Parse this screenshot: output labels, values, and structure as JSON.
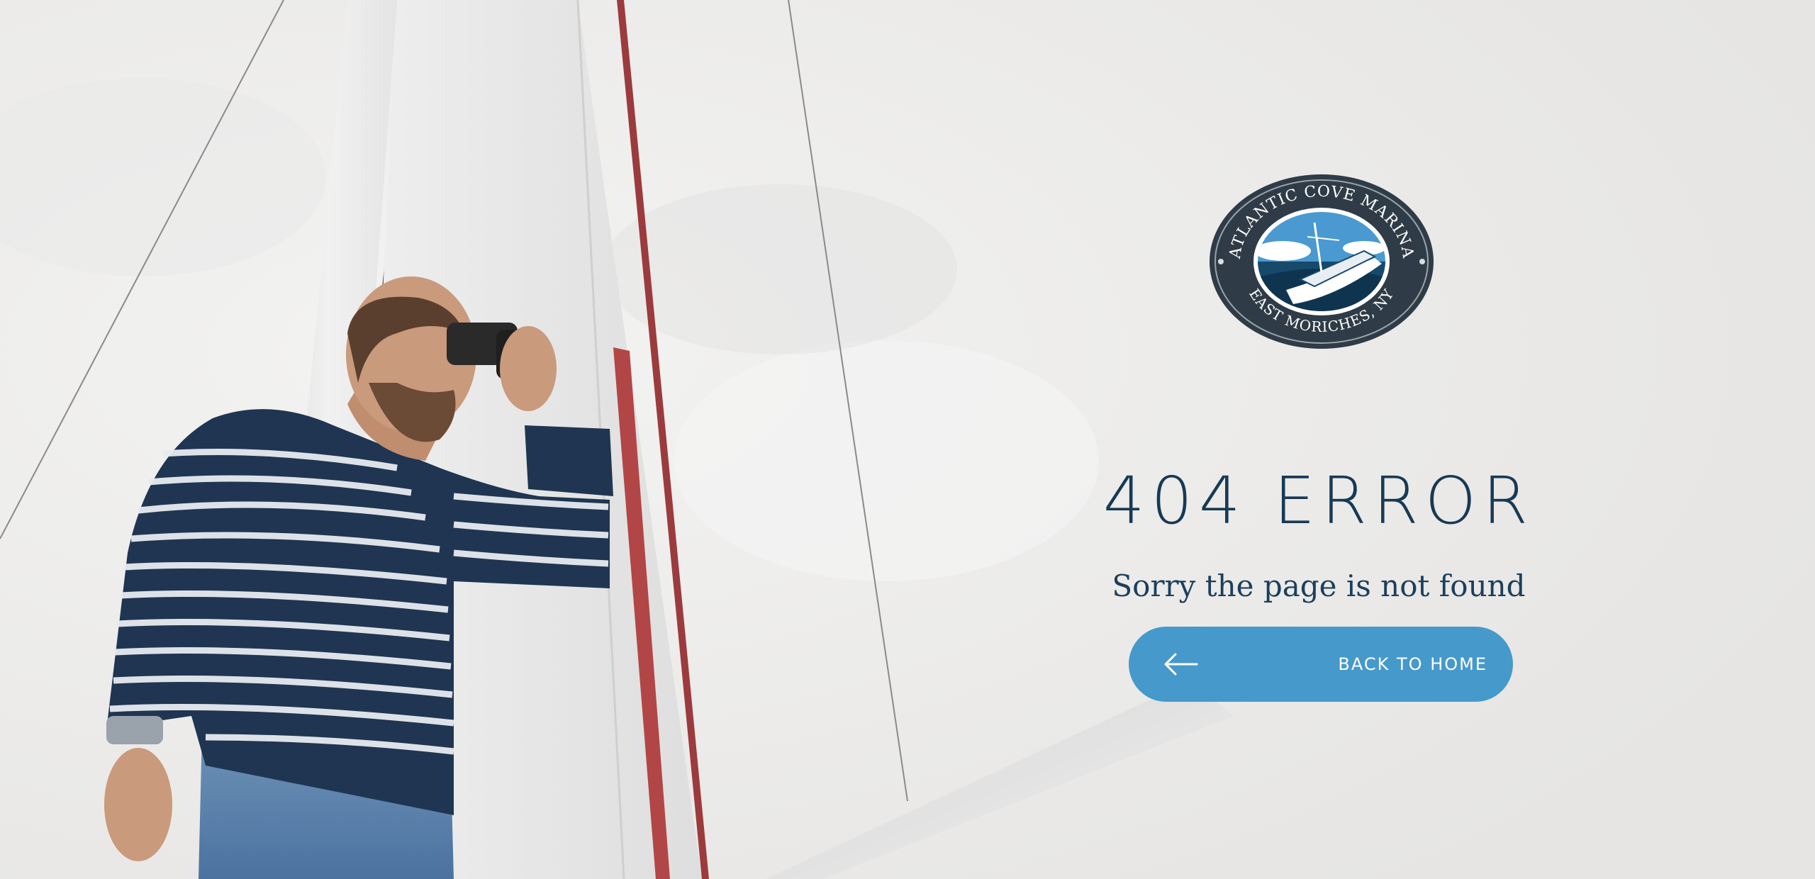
{
  "logo": {
    "top_text": "ATLANTIC COVE MARINA",
    "bottom_text": "EAST MORICHES, NY"
  },
  "error": {
    "title": "404 ERROR",
    "message": "Sorry the page is not found"
  },
  "back_button": {
    "label": "BACK TO HOME",
    "icon": "arrow-left-icon"
  },
  "colors": {
    "navy": "#173a55",
    "button": "#4699cb",
    "background": "#e8e8e6"
  }
}
